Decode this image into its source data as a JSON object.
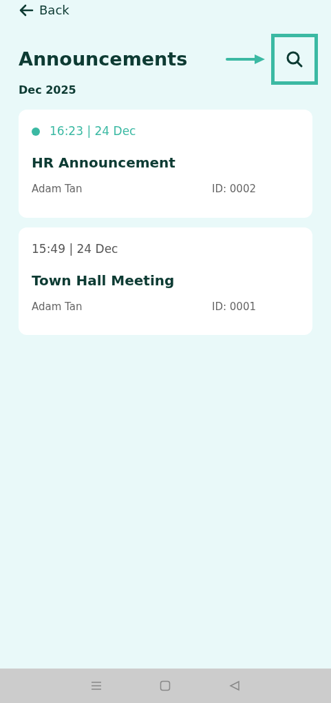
{
  "back": {
    "label": "Back"
  },
  "title": "Announcements",
  "highlight": {
    "search_marked": true
  },
  "month": "Dec 2025",
  "announcements": [
    {
      "time": "16:23 | 24 Dec",
      "unread": true,
      "title": "HR Announcement",
      "author": "Adam Tan",
      "id": "ID: 0002"
    },
    {
      "time": "15:49 | 24 Dec",
      "unread": false,
      "title": "Town Hall Meeting",
      "author": "Adam Tan",
      "id": "ID: 0001"
    }
  ]
}
